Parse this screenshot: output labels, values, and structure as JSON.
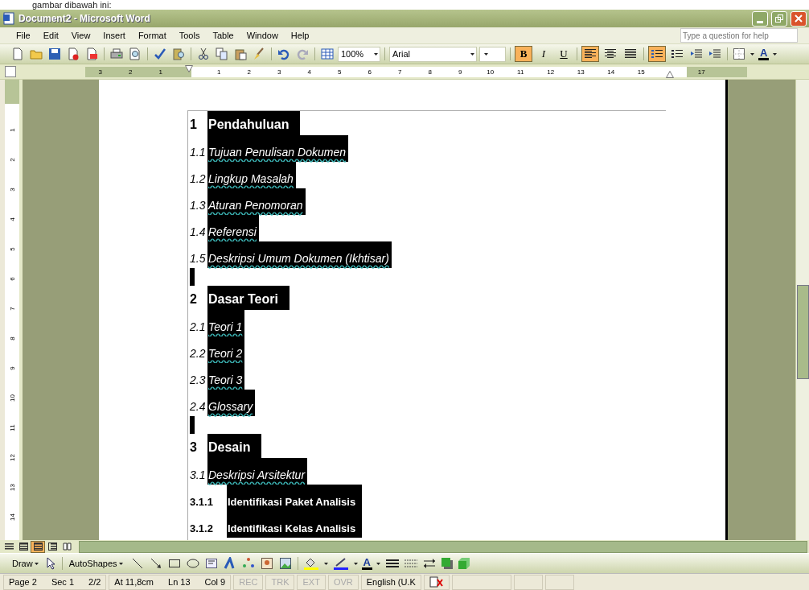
{
  "caption": "gambar dibawah ini:",
  "window": {
    "title": "Document2 - Microsoft Word"
  },
  "menu": [
    "File",
    "Edit",
    "View",
    "Insert",
    "Format",
    "Tools",
    "Table",
    "Window",
    "Help"
  ],
  "help_box": {
    "placeholder": "Type a question for help"
  },
  "zoom": "100%",
  "font": "Arial",
  "format_toggles": [
    {
      "label": "B",
      "on": true
    },
    {
      "label": "I",
      "on": false
    },
    {
      "label": "U",
      "on": false
    }
  ],
  "alignment_buttons": [
    {
      "selected": true
    },
    {
      "selected": false
    },
    {
      "selected": false
    }
  ],
  "list_buttons": [
    {
      "on": true
    },
    {
      "on": false
    }
  ],
  "font_color_label": "A",
  "ruler": {
    "left_labels": [
      "3",
      "2",
      "1"
    ],
    "labels": [
      "1",
      "2",
      "3",
      "4",
      "5",
      "6",
      "7",
      "8",
      "9",
      "10",
      "11",
      "12",
      "13",
      "14",
      "15"
    ],
    "right_labels": [
      "17"
    ]
  },
  "vertical_ruler": [
    "1",
    "2",
    "3",
    "4",
    "5",
    "6",
    "7",
    "8",
    "9",
    "10",
    "11",
    "12",
    "13",
    "14"
  ],
  "document": [
    {
      "kind": "h1",
      "number": "1",
      "text": "Pendahuluan",
      "highlighted": true
    },
    {
      "kind": "h2",
      "number": "1.1",
      "text": "Tujuan Penulisan Dokumen",
      "highlighted": true
    },
    {
      "kind": "h2",
      "number": "1.2",
      "text": "Lingkup Masalah",
      "highlighted": true
    },
    {
      "kind": "h2",
      "number": "1.3",
      "text": "Aturan Penomoran",
      "highlighted": true
    },
    {
      "kind": "h2",
      "number": "1.4",
      "text": "Referensi",
      "highlighted": true
    },
    {
      "kind": "h2",
      "number": "1.5",
      "text": "Deskripsi Umum Dokumen (Ikhtisar)",
      "highlighted": true
    },
    {
      "kind": "blank",
      "highlighted": true
    },
    {
      "kind": "h1",
      "number": "2",
      "text": "Dasar Teori",
      "highlighted": true
    },
    {
      "kind": "h2",
      "number": "2.1",
      "text": "Teori 1",
      "highlighted": true
    },
    {
      "kind": "h2",
      "number": "2.2",
      "text": "Teori 2",
      "highlighted": true
    },
    {
      "kind": "h2",
      "number": "2.3",
      "text": "Teori 3",
      "highlighted": true
    },
    {
      "kind": "h2",
      "number": "2.4",
      "text": "Glossary",
      "highlighted": true
    },
    {
      "kind": "blank",
      "highlighted": true
    },
    {
      "kind": "h1",
      "number": "3",
      "text": "Desain",
      "highlighted": true
    },
    {
      "kind": "h2",
      "number": "3.1",
      "text": "Deskripsi Arsitektur",
      "highlighted": true
    },
    {
      "kind": "h3",
      "number": "3.1.1",
      "text": "Identifikasi Paket Analisis",
      "highlighted": true
    },
    {
      "kind": "h3",
      "number": "3.1.2",
      "text": "Identifikasi Kelas Analisis",
      "highlighted": true
    }
  ],
  "view_buttons": [
    {
      "selected": false
    },
    {
      "selected": false
    },
    {
      "selected": true
    },
    {
      "selected": false
    },
    {
      "selected": false
    }
  ],
  "draw_toolbar": {
    "draw": "Draw",
    "autoshapes": "AutoShapes",
    "font_color_label": "A"
  },
  "status_bar": [
    {
      "text": "Page 2",
      "disabled": false
    },
    {
      "text": "Sec 1",
      "disabled": false
    },
    {
      "text": "2/2",
      "disabled": false
    },
    {
      "text": "At 11,8cm",
      "disabled": false
    },
    {
      "text": "Ln 13",
      "disabled": false
    },
    {
      "text": "Col 9",
      "disabled": false
    },
    {
      "text": "REC",
      "disabled": true
    },
    {
      "text": "TRK",
      "disabled": true
    },
    {
      "text": "EXT",
      "disabled": true
    },
    {
      "text": "OVR",
      "disabled": true
    },
    {
      "text": "English (U.K",
      "disabled": false
    }
  ]
}
